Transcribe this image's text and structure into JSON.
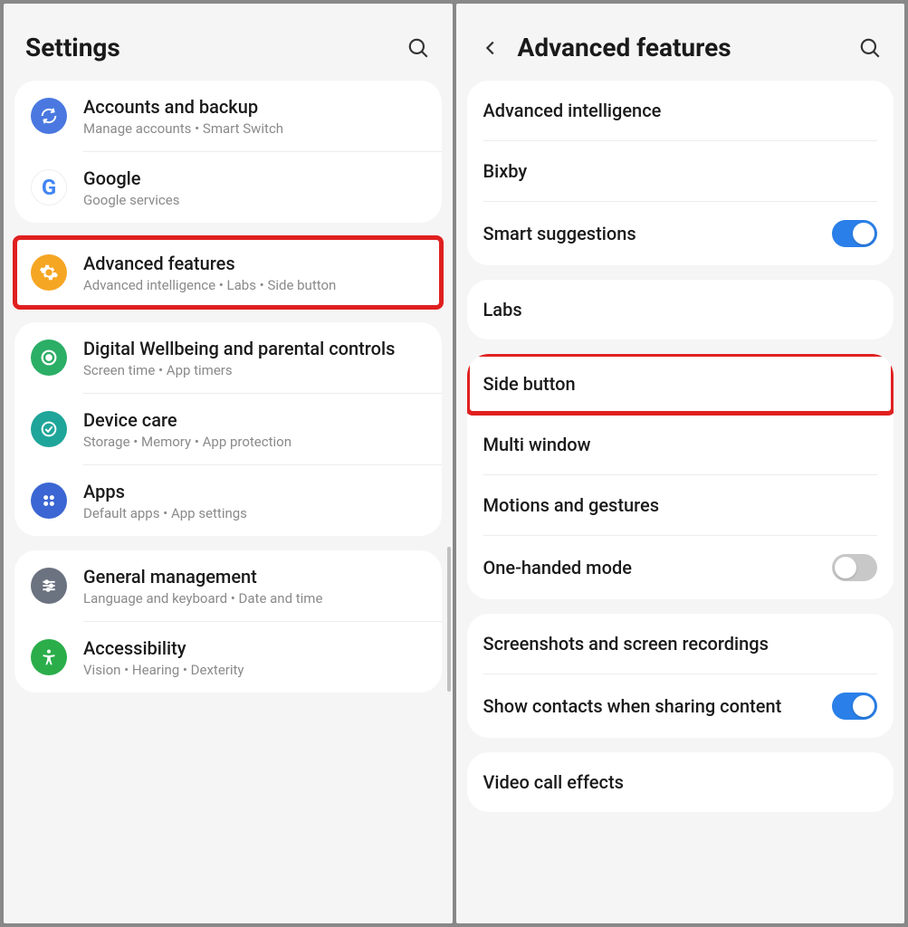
{
  "left": {
    "title": "Settings",
    "groups": [
      {
        "items": [
          {
            "icon": "sync-icon",
            "iconClass": "icon-blue",
            "title": "Accounts and backup",
            "sub": "Manage accounts  •  Smart Switch"
          },
          {
            "icon": "google-icon",
            "iconClass": "icon-google",
            "title": "Google",
            "sub": "Google services"
          }
        ]
      },
      {
        "highlight": true,
        "items": [
          {
            "icon": "gear-icon",
            "iconClass": "icon-orange",
            "title": "Advanced features",
            "sub": "Advanced intelligence  •  Labs  •  Side button"
          }
        ]
      },
      {
        "items": [
          {
            "icon": "wellbeing-icon",
            "iconClass": "icon-green",
            "title": "Digital Wellbeing and parental controls",
            "sub": "Screen time  •  App timers"
          },
          {
            "icon": "device-care-icon",
            "iconClass": "icon-teal",
            "title": "Device care",
            "sub": "Storage  •  Memory  •  App protection"
          },
          {
            "icon": "apps-icon",
            "iconClass": "icon-blue2",
            "title": "Apps",
            "sub": "Default apps  •  App settings"
          }
        ]
      },
      {
        "items": [
          {
            "icon": "sliders-icon",
            "iconClass": "icon-slate",
            "title": "General management",
            "sub": "Language and keyboard  •  Date and time"
          },
          {
            "icon": "accessibility-icon",
            "iconClass": "icon-green2",
            "title": "Accessibility",
            "sub": "Vision  •  Hearing  •  Dexterity"
          }
        ]
      }
    ]
  },
  "right": {
    "title": "Advanced features",
    "groups": [
      {
        "items": [
          {
            "title": "Advanced intelligence"
          },
          {
            "title": "Bixby"
          },
          {
            "title": "Smart suggestions",
            "toggle": "on"
          }
        ]
      },
      {
        "items": [
          {
            "title": "Labs"
          }
        ]
      },
      {
        "items": [
          {
            "title": "Side button",
            "highlight": true
          },
          {
            "title": "Multi window"
          },
          {
            "title": "Motions and gestures"
          },
          {
            "title": "One-handed mode",
            "toggle": "off"
          }
        ]
      },
      {
        "items": [
          {
            "title": "Screenshots and screen recordings"
          },
          {
            "title": "Show contacts when sharing content",
            "toggle": "on"
          }
        ]
      },
      {
        "items": [
          {
            "title": "Video call effects"
          }
        ]
      }
    ]
  }
}
